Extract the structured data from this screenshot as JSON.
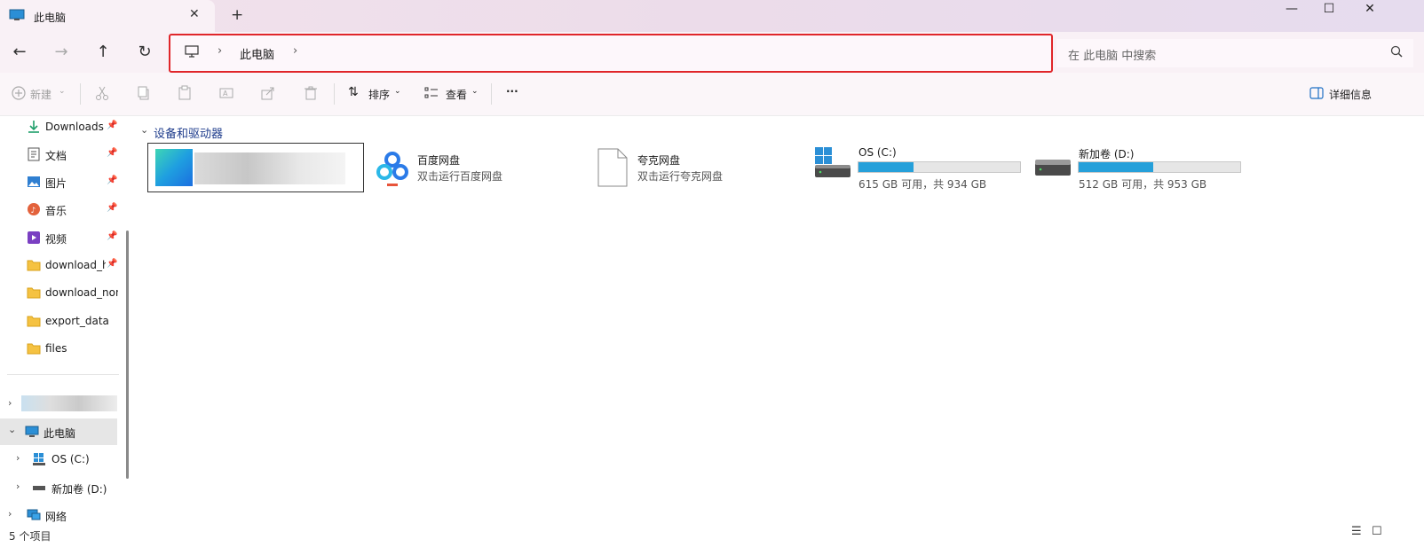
{
  "tab": {
    "title": "此电脑",
    "close": "✕",
    "new_tab": "+"
  },
  "window": {
    "minimize": "—",
    "maximize": "☐",
    "close": "✕"
  },
  "nav": {
    "back": "←",
    "forward": "→",
    "up": "↑",
    "refresh": "↻"
  },
  "address": {
    "separator": "›",
    "location": "此电脑"
  },
  "search": {
    "placeholder": "在 此电脑 中搜索"
  },
  "commands": {
    "new": "新建",
    "sort": "排序",
    "view": "查看",
    "more": "···",
    "details": "详细信息"
  },
  "sidebar": {
    "quick": [
      {
        "label": "Downloads",
        "pinned": true,
        "icon": "download-icon"
      },
      {
        "label": "文档",
        "pinned": true,
        "icon": "document-icon"
      },
      {
        "label": "图片",
        "pinned": true,
        "icon": "picture-icon"
      },
      {
        "label": "音乐",
        "pinned": true,
        "icon": "music-icon"
      },
      {
        "label": "视频",
        "pinned": true,
        "icon": "video-icon"
      },
      {
        "label": "download_h",
        "pinned": true,
        "icon": "folder-icon"
      },
      {
        "label": "download_non",
        "pinned": false,
        "icon": "folder-icon"
      },
      {
        "label": "export_data",
        "pinned": false,
        "icon": "folder-icon"
      },
      {
        "label": "files",
        "pinned": false,
        "icon": "folder-icon"
      }
    ],
    "tree": {
      "this_pc": "此电脑",
      "drive_c": "OS (C:)",
      "drive_d": "新加卷 (D:)",
      "network": "网络"
    },
    "pin_glyph": "📌"
  },
  "main": {
    "group_title": "设备和驱动器",
    "items": {
      "baidu": {
        "name": "百度网盘",
        "sub": "双击运行百度网盘"
      },
      "quark": {
        "name": "夸克网盘",
        "sub": "双击运行夸克网盘"
      },
      "drive_c": {
        "name": "OS (C:)",
        "sub": "615 GB 可用，共 934 GB",
        "used_fraction": 0.342
      },
      "drive_d": {
        "name": "新加卷 (D:)",
        "sub": "512 GB 可用，共 953 GB",
        "used_fraction": 0.463
      }
    }
  },
  "status": {
    "count": "5 个项目",
    "list_view": "☰",
    "tile_view": "☐"
  },
  "colors": {
    "accent": "#26a0da",
    "highlight_border": "#e0262a",
    "group_title": "#1e3c8c"
  }
}
